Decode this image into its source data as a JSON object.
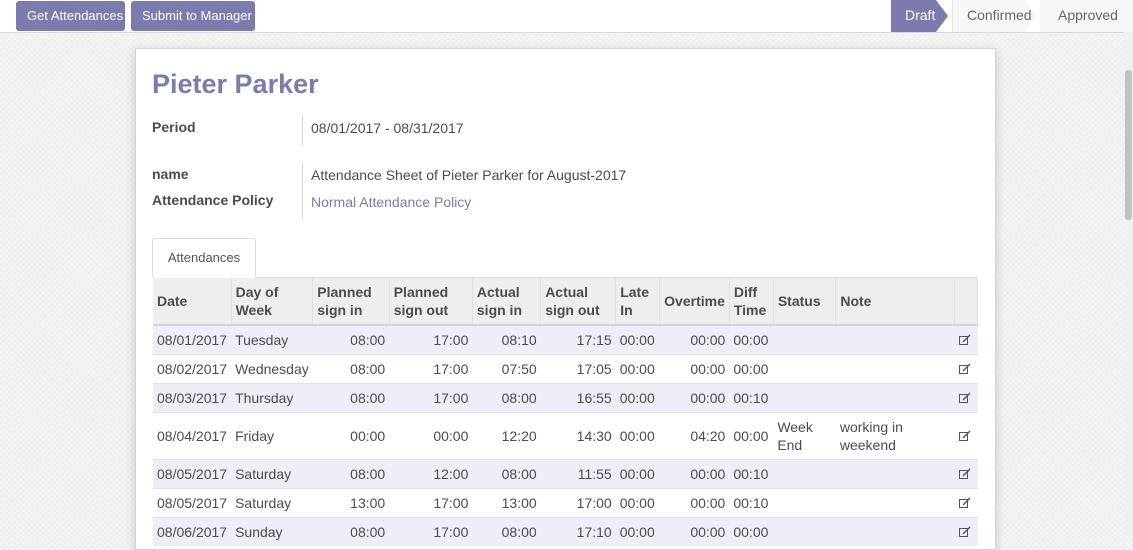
{
  "actions": {
    "get_attendances": "Get Attendances",
    "submit_to_manager": "Submit to Manager"
  },
  "stages": [
    "Draft",
    "Confirmed",
    "Approved"
  ],
  "record": {
    "title": "Pieter Parker",
    "period_label": "Period",
    "period_value": "08/01/2017 - 08/31/2017",
    "name_label": "name",
    "name_value": "Attendance Sheet of Pieter Parker for August-2017",
    "policy_label": "Attendance Policy",
    "policy_value": "Normal Attendance Policy"
  },
  "tab": {
    "label": "Attendances"
  },
  "table": {
    "headers": [
      "Date",
      "Day of Week",
      "Planned sign in",
      "Planned sign out",
      "Actual sign in",
      "Actual sign out",
      "Late In",
      "Overtime",
      "Diff Time",
      "Status",
      "Note"
    ],
    "rows": [
      {
        "date": "08/01/2017",
        "day": "Tuesday",
        "p_in": "08:00",
        "p_out": "17:00",
        "a_in": "08:10",
        "a_out": "17:15",
        "late": "00:00",
        "ot": "00:00",
        "diff": "00:00",
        "status": "",
        "note": ""
      },
      {
        "date": "08/02/2017",
        "day": "Wednesday",
        "p_in": "08:00",
        "p_out": "17:00",
        "a_in": "07:50",
        "a_out": "17:05",
        "late": "00:00",
        "ot": "00:00",
        "diff": "00:00",
        "status": "",
        "note": ""
      },
      {
        "date": "08/03/2017",
        "day": "Thursday",
        "p_in": "08:00",
        "p_out": "17:00",
        "a_in": "08:00",
        "a_out": "16:55",
        "late": "00:00",
        "ot": "00:00",
        "diff": "00:10",
        "status": "",
        "note": ""
      },
      {
        "date": "08/04/2017",
        "day": "Friday",
        "p_in": "00:00",
        "p_out": "00:00",
        "a_in": "12:20",
        "a_out": "14:30",
        "late": "00:00",
        "ot": "04:20",
        "diff": "00:00",
        "status": "Week End",
        "note": "working in weekend"
      },
      {
        "date": "08/05/2017",
        "day": "Saturday",
        "p_in": "08:00",
        "p_out": "12:00",
        "a_in": "08:00",
        "a_out": "11:55",
        "late": "00:00",
        "ot": "00:00",
        "diff": "00:10",
        "status": "",
        "note": ""
      },
      {
        "date": "08/05/2017",
        "day": "Saturday",
        "p_in": "13:00",
        "p_out": "17:00",
        "a_in": "13:00",
        "a_out": "17:00",
        "late": "00:00",
        "ot": "00:00",
        "diff": "00:10",
        "status": "",
        "note": ""
      },
      {
        "date": "08/06/2017",
        "day": "Sunday",
        "p_in": "08:00",
        "p_out": "17:00",
        "a_in": "08:00",
        "a_out": "17:10",
        "late": "00:00",
        "ot": "00:00",
        "diff": "00:00",
        "status": "",
        "note": ""
      }
    ]
  },
  "colors": {
    "accent": "#7c7bad",
    "row_alt": "#eeeef8",
    "header_bg": "#eeeeee"
  },
  "icons": {
    "row_edit": "edit-icon"
  }
}
